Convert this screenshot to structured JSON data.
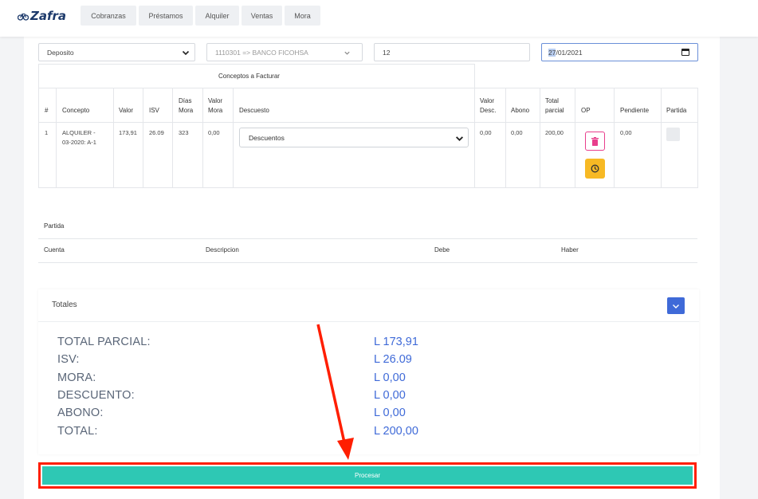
{
  "brand": {
    "name": "Zafra"
  },
  "nav": {
    "tabs": [
      {
        "label": "Cobranzas"
      },
      {
        "label": "Préstamos"
      },
      {
        "label": "Alquiler"
      },
      {
        "label": "Ventas"
      },
      {
        "label": "Mora"
      }
    ]
  },
  "form": {
    "payment_method": "Deposito",
    "bank_account": "1110301 => BANCO FICOHSA",
    "reference": "12",
    "date_day": "27",
    "date_rest": "/01/2021"
  },
  "table": {
    "group_header": "Conceptos a Facturar",
    "headers": {
      "num": "#",
      "concepto": "Concepto",
      "valor": "Valor",
      "isv": "ISV",
      "dias_mora_1": "Días",
      "dias_mora_2": "Mora",
      "valor_mora_1": "Valor",
      "valor_mora_2": "Mora",
      "descuesto": "Descuesto",
      "valor_desc_1": "Valor",
      "valor_desc_2": "Desc.",
      "abono": "Abono",
      "total_parcial_1": "Total",
      "total_parcial_2": "parcial",
      "op": "OP",
      "pendiente": "Pendiente",
      "partida": "Partida"
    },
    "rows": [
      {
        "num": "1",
        "concepto_1": "ALQUILER -",
        "concepto_2": "03-2020: A-1",
        "valor": "173,91",
        "isv": "26.09",
        "dias_mora": "323",
        "valor_mora": "0,00",
        "descuento_select": "Descuentos",
        "valor_desc": "0,00",
        "abono": "0,00",
        "total_parcial": "200,00",
        "pendiente": "0,00"
      }
    ]
  },
  "partida": {
    "title": "Partida",
    "headers": {
      "cuenta": "Cuenta",
      "descripcion": "Descripcion",
      "debe": "Debe",
      "haber": "Haber"
    }
  },
  "totals": {
    "title": "Totales",
    "items": [
      {
        "label": "TOTAL PARCIAL:",
        "value": "L 173,91"
      },
      {
        "label": "ISV:",
        "value": "L 26.09"
      },
      {
        "label": "MORA:",
        "value": "L 0,00"
      },
      {
        "label": "DESCUENTO:",
        "value": "L 0,00"
      },
      {
        "label": "ABONO:",
        "value": "L 0,00"
      },
      {
        "label": "TOTAL:",
        "value": "L 200,00"
      }
    ]
  },
  "actions": {
    "process_label": "Procesar"
  },
  "colors": {
    "accent": "#3f6ad8",
    "process": "#2ec8b4",
    "annotation": "#ff1e00",
    "delete": "#e83e8c",
    "warning": "#f7b924"
  },
  "icons": {
    "logo": "bicycle-icon",
    "delete": "trash-icon",
    "clock": "clock-icon",
    "collapse": "chevron-down-icon",
    "calendar": "calendar-icon"
  }
}
